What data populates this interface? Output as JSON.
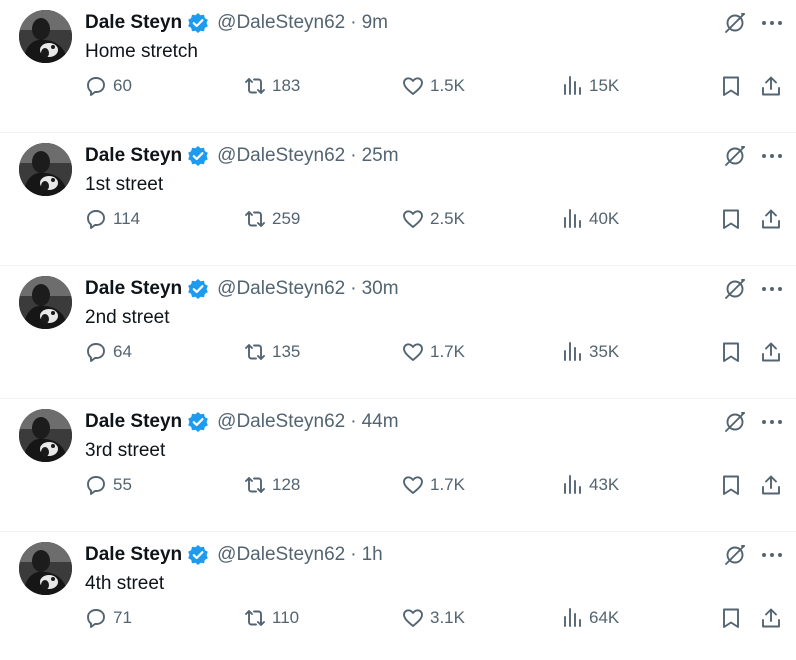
{
  "colors": {
    "verified": "#1d9bf0",
    "text_primary": "#0f1419",
    "text_secondary": "#536471",
    "divider": "#eff3f4"
  },
  "icons": {
    "reply": "reply-icon",
    "retweet": "retweet-icon",
    "like": "heart-icon",
    "views": "views-bar-chart-icon",
    "bookmark": "bookmark-icon",
    "share": "share-icon",
    "grok": "grok-icon",
    "more": "more-icon",
    "verified": "verified-badge-icon"
  },
  "tweets": [
    {
      "name": "Dale Steyn",
      "handle": "@DaleSteyn62",
      "dot": "·",
      "time": "9m",
      "text": "Home stretch",
      "replies": "60",
      "retweets": "183",
      "likes": "1.5K",
      "views": "15K"
    },
    {
      "name": "Dale Steyn",
      "handle": "@DaleSteyn62",
      "dot": "·",
      "time": "25m",
      "text": "1st street",
      "replies": "114",
      "retweets": "259",
      "likes": "2.5K",
      "views": "40K"
    },
    {
      "name": "Dale Steyn",
      "handle": "@DaleSteyn62",
      "dot": "·",
      "time": "30m",
      "text": "2nd street",
      "replies": "64",
      "retweets": "135",
      "likes": "1.7K",
      "views": "35K"
    },
    {
      "name": "Dale Steyn",
      "handle": "@DaleSteyn62",
      "dot": "·",
      "time": "44m",
      "text": "3rd street",
      "replies": "55",
      "retweets": "128",
      "likes": "1.7K",
      "views": "43K"
    },
    {
      "name": "Dale Steyn",
      "handle": "@DaleSteyn62",
      "dot": "·",
      "time": "1h",
      "text": "4th street",
      "replies": "71",
      "retweets": "110",
      "likes": "3.1K",
      "views": "64K"
    }
  ]
}
